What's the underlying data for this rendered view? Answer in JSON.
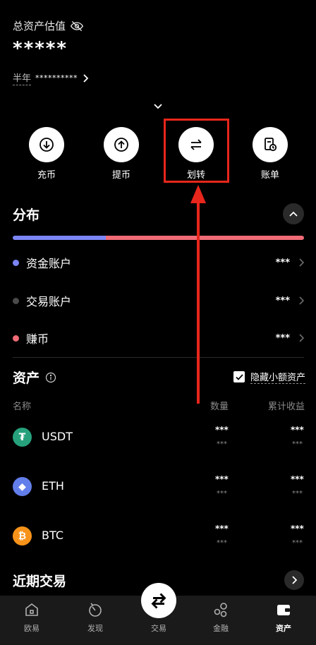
{
  "summary": {
    "total_label": "总资产估值",
    "total_value": "*****",
    "period_label": "半年",
    "period_value": "**********"
  },
  "actions": [
    {
      "label": "充币",
      "icon": "deposit-icon"
    },
    {
      "label": "提币",
      "icon": "withdraw-icon"
    },
    {
      "label": "划转",
      "icon": "transfer-icon"
    },
    {
      "label": "账单",
      "icon": "bill-icon"
    }
  ],
  "distribution": {
    "title": "分布",
    "bar": [
      {
        "color": "#7b85f5",
        "fraction": 0.32
      },
      {
        "color": "#f06b76",
        "fraction": 0.68
      }
    ],
    "accounts": [
      {
        "name": "资金账户",
        "value": "***",
        "color": "#7b85f5"
      },
      {
        "name": "交易账户",
        "value": "***",
        "color": "#4a4a4a"
      },
      {
        "name": "赚币",
        "value": "***",
        "color": "#f06b76"
      }
    ]
  },
  "assets": {
    "title": "资产",
    "hide_small_label": "隐藏小额资产",
    "hide_small_checked": true,
    "columns": {
      "name": "名称",
      "quantity": "数量",
      "pnl": "累计收益"
    },
    "rows": [
      {
        "symbol": "USDT",
        "icon": "usdt-icon",
        "icon_color": "#26a17b",
        "icon_glyph": "₮",
        "qty_top": "***",
        "qty_bottom": "***",
        "pnl_top": "***",
        "pnl_bottom": "***"
      },
      {
        "symbol": "ETH",
        "icon": "eth-icon",
        "icon_color": "#627eea",
        "icon_glyph": "◆",
        "qty_top": "***",
        "qty_bottom": "***",
        "pnl_top": "***",
        "pnl_bottom": "***"
      },
      {
        "symbol": "BTC",
        "icon": "btc-icon",
        "icon_color": "#f7931a",
        "icon_glyph": "₿",
        "qty_top": "***",
        "qty_bottom": "***",
        "pnl_top": "***",
        "pnl_bottom": "***"
      }
    ]
  },
  "recent": {
    "title": "近期交易"
  },
  "nav": {
    "items": [
      {
        "label": "欧易",
        "icon": "home-icon"
      },
      {
        "label": "发现",
        "icon": "discover-icon"
      },
      {
        "label": "交易",
        "icon": "trade-icon"
      },
      {
        "label": "金融",
        "icon": "finance-icon"
      },
      {
        "label": "资产",
        "icon": "wallet-icon",
        "active": true
      }
    ]
  },
  "annotation": {
    "color": "#e8261b"
  }
}
